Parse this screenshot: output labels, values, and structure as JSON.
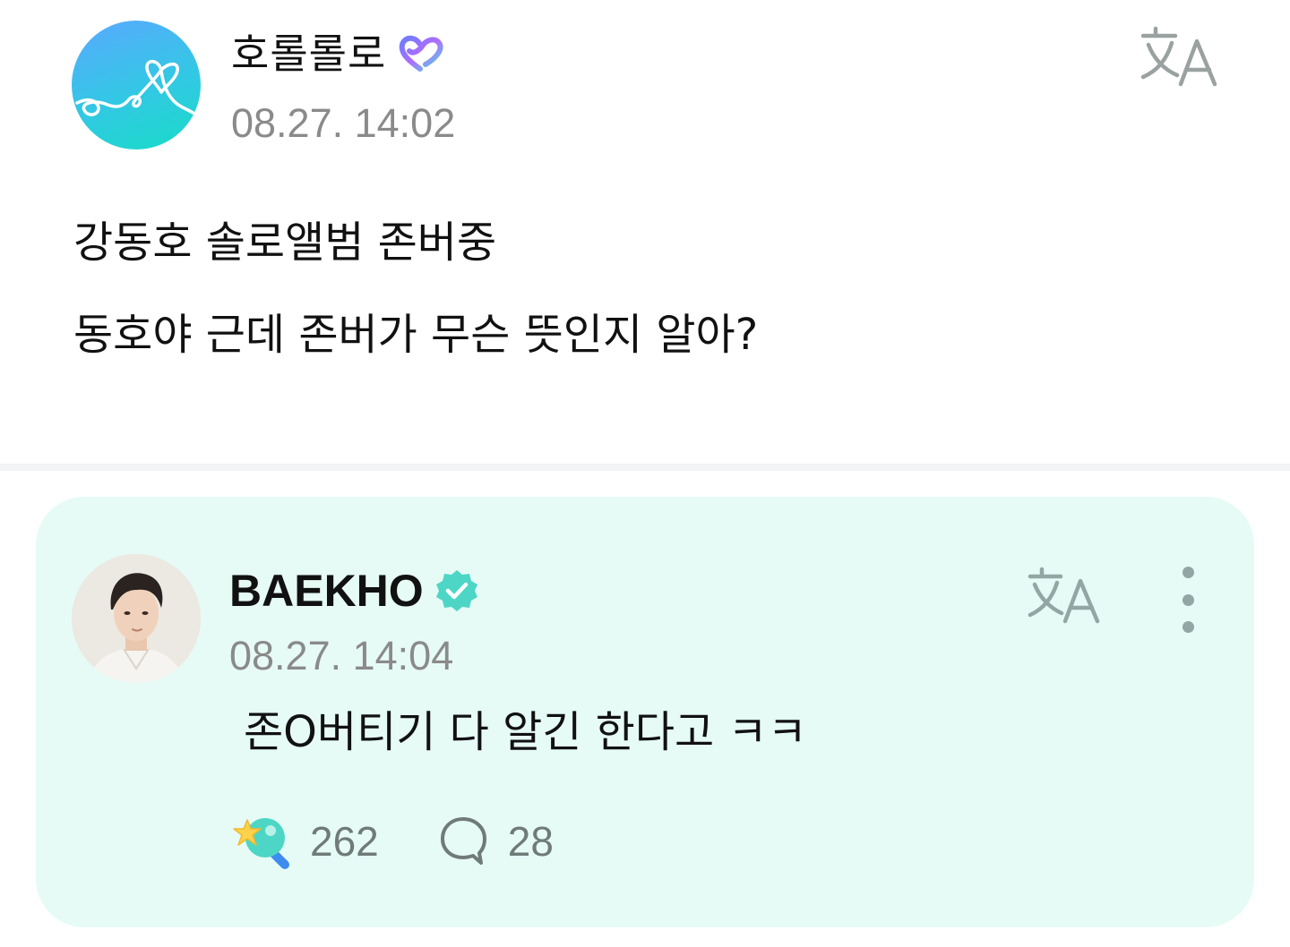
{
  "post": {
    "author": "호롤롤로",
    "author_badge_icon": "membership-heart-icon",
    "timestamp": "08.27. 14:02",
    "lines": [
      "강동호 솔로앨범 존버중",
      "동호야 근데 존버가 무슨 뜻인지 알아?"
    ],
    "translate_icon": "translate-icon"
  },
  "comment": {
    "author": "BAEKHO",
    "verified_icon": "verified-badge-icon",
    "timestamp": "08.27. 14:04",
    "text": "존O버티기 다 알긴 한다고 ㅋㅋ",
    "translate_icon": "translate-icon",
    "more_icon": "more-vertical-icon",
    "likes": "262",
    "replies": "28",
    "like_icon": "cheer-wand-icon",
    "reply_icon": "speech-bubble-icon"
  },
  "colors": {
    "card_background": "#e6fbf6",
    "timestamp_gray": "#8a8a8a",
    "icon_teal_gray": "#92a6a4",
    "verified_teal": "#4dd6c6",
    "membership_gradient": [
      "#6b7dff",
      "#b06cff",
      "#4fd8e0"
    ],
    "avatar_gradient": [
      "#5aa9ff",
      "#18dcc6"
    ]
  }
}
